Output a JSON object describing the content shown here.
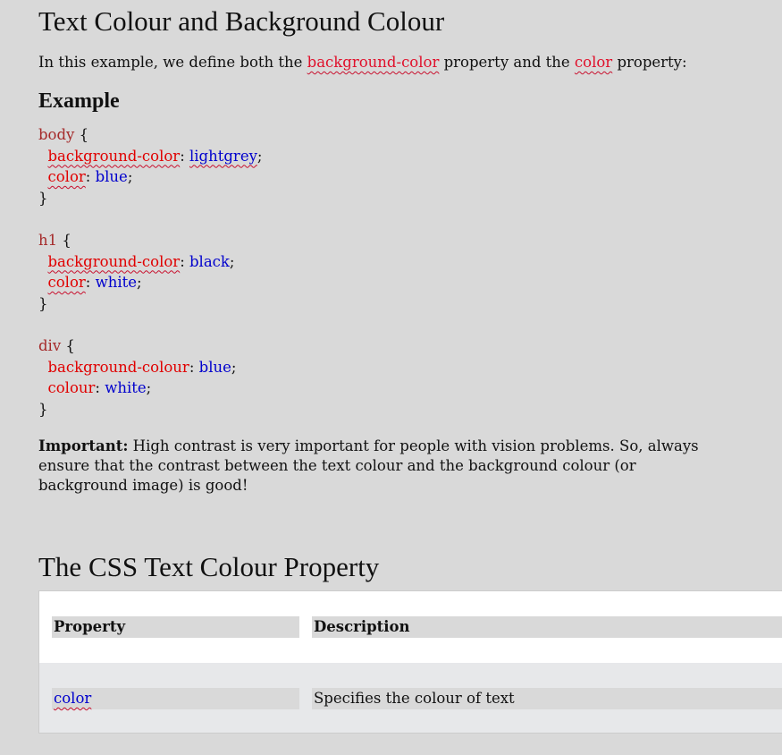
{
  "heading": "Text Colour and Background Colour",
  "intro": {
    "part1": "In this example, we define both the ",
    "term1": "background-color",
    "part2": " property and the ",
    "term2": "color",
    "part3": " property:"
  },
  "example_heading": "Example",
  "code": {
    "block1": {
      "selector": "body",
      "open": " {",
      "p1": "background-color",
      "v1": "lightgrey",
      "p2": "color",
      "v2": "blue",
      "close": "}"
    },
    "block2": {
      "selector": "h1",
      "open": " {",
      "p1": "background-color",
      "v1": "black",
      "p2": "color",
      "v2": "white",
      "close": "}"
    },
    "block3": {
      "selector": "div",
      "open": " {",
      "p1": "background-colour",
      "v1": "blue",
      "p2": "colour",
      "v2": "white",
      "close": "}"
    }
  },
  "important": {
    "label": "Important:",
    "text": " High contrast is very important for people with vision problems. So, always ensure that the contrast between the text colour and the background colour (or background image) is good!"
  },
  "section_heading": "The CSS Text Colour Property",
  "table": {
    "headers": [
      "Property",
      "Description"
    ],
    "rows": [
      {
        "property": "color",
        "description": "Specifies the colour of text"
      }
    ]
  },
  "colors": {
    "background": "#d9d9d9",
    "selector": "#a52a2a",
    "property": "#e00000",
    "value": "#0000cd",
    "highlight": "#e0102b"
  }
}
